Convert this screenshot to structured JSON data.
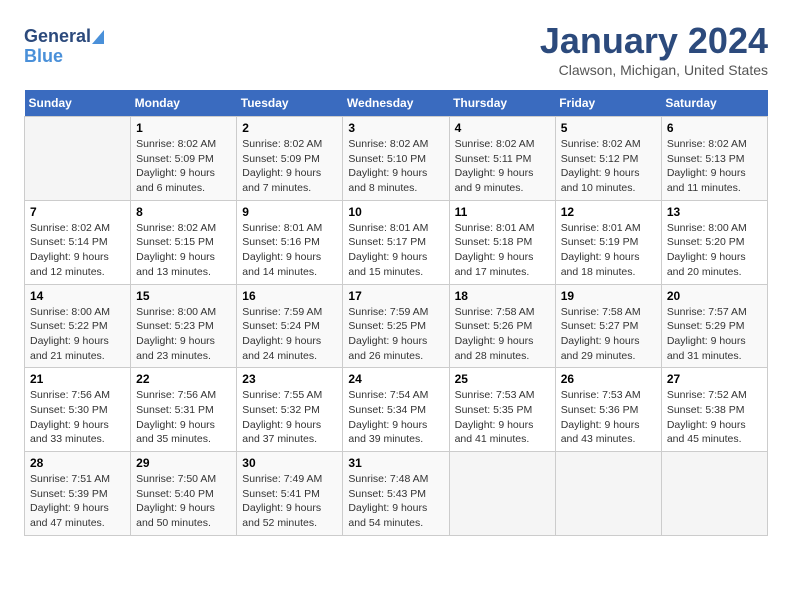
{
  "header": {
    "logo_general": "General",
    "logo_blue": "Blue",
    "main_title": "January 2024",
    "subtitle": "Clawson, Michigan, United States"
  },
  "calendar": {
    "days_of_week": [
      "Sunday",
      "Monday",
      "Tuesday",
      "Wednesday",
      "Thursday",
      "Friday",
      "Saturday"
    ],
    "weeks": [
      [
        {
          "day": "",
          "info": ""
        },
        {
          "day": "1",
          "info": "Sunrise: 8:02 AM\nSunset: 5:09 PM\nDaylight: 9 hours\nand 6 minutes."
        },
        {
          "day": "2",
          "info": "Sunrise: 8:02 AM\nSunset: 5:09 PM\nDaylight: 9 hours\nand 7 minutes."
        },
        {
          "day": "3",
          "info": "Sunrise: 8:02 AM\nSunset: 5:10 PM\nDaylight: 9 hours\nand 8 minutes."
        },
        {
          "day": "4",
          "info": "Sunrise: 8:02 AM\nSunset: 5:11 PM\nDaylight: 9 hours\nand 9 minutes."
        },
        {
          "day": "5",
          "info": "Sunrise: 8:02 AM\nSunset: 5:12 PM\nDaylight: 9 hours\nand 10 minutes."
        },
        {
          "day": "6",
          "info": "Sunrise: 8:02 AM\nSunset: 5:13 PM\nDaylight: 9 hours\nand 11 minutes."
        }
      ],
      [
        {
          "day": "7",
          "info": "Sunrise: 8:02 AM\nSunset: 5:14 PM\nDaylight: 9 hours\nand 12 minutes."
        },
        {
          "day": "8",
          "info": "Sunrise: 8:02 AM\nSunset: 5:15 PM\nDaylight: 9 hours\nand 13 minutes."
        },
        {
          "day": "9",
          "info": "Sunrise: 8:01 AM\nSunset: 5:16 PM\nDaylight: 9 hours\nand 14 minutes."
        },
        {
          "day": "10",
          "info": "Sunrise: 8:01 AM\nSunset: 5:17 PM\nDaylight: 9 hours\nand 15 minutes."
        },
        {
          "day": "11",
          "info": "Sunrise: 8:01 AM\nSunset: 5:18 PM\nDaylight: 9 hours\nand 17 minutes."
        },
        {
          "day": "12",
          "info": "Sunrise: 8:01 AM\nSunset: 5:19 PM\nDaylight: 9 hours\nand 18 minutes."
        },
        {
          "day": "13",
          "info": "Sunrise: 8:00 AM\nSunset: 5:20 PM\nDaylight: 9 hours\nand 20 minutes."
        }
      ],
      [
        {
          "day": "14",
          "info": "Sunrise: 8:00 AM\nSunset: 5:22 PM\nDaylight: 9 hours\nand 21 minutes."
        },
        {
          "day": "15",
          "info": "Sunrise: 8:00 AM\nSunset: 5:23 PM\nDaylight: 9 hours\nand 23 minutes."
        },
        {
          "day": "16",
          "info": "Sunrise: 7:59 AM\nSunset: 5:24 PM\nDaylight: 9 hours\nand 24 minutes."
        },
        {
          "day": "17",
          "info": "Sunrise: 7:59 AM\nSunset: 5:25 PM\nDaylight: 9 hours\nand 26 minutes."
        },
        {
          "day": "18",
          "info": "Sunrise: 7:58 AM\nSunset: 5:26 PM\nDaylight: 9 hours\nand 28 minutes."
        },
        {
          "day": "19",
          "info": "Sunrise: 7:58 AM\nSunset: 5:27 PM\nDaylight: 9 hours\nand 29 minutes."
        },
        {
          "day": "20",
          "info": "Sunrise: 7:57 AM\nSunset: 5:29 PM\nDaylight: 9 hours\nand 31 minutes."
        }
      ],
      [
        {
          "day": "21",
          "info": "Sunrise: 7:56 AM\nSunset: 5:30 PM\nDaylight: 9 hours\nand 33 minutes."
        },
        {
          "day": "22",
          "info": "Sunrise: 7:56 AM\nSunset: 5:31 PM\nDaylight: 9 hours\nand 35 minutes."
        },
        {
          "day": "23",
          "info": "Sunrise: 7:55 AM\nSunset: 5:32 PM\nDaylight: 9 hours\nand 37 minutes."
        },
        {
          "day": "24",
          "info": "Sunrise: 7:54 AM\nSunset: 5:34 PM\nDaylight: 9 hours\nand 39 minutes."
        },
        {
          "day": "25",
          "info": "Sunrise: 7:53 AM\nSunset: 5:35 PM\nDaylight: 9 hours\nand 41 minutes."
        },
        {
          "day": "26",
          "info": "Sunrise: 7:53 AM\nSunset: 5:36 PM\nDaylight: 9 hours\nand 43 minutes."
        },
        {
          "day": "27",
          "info": "Sunrise: 7:52 AM\nSunset: 5:38 PM\nDaylight: 9 hours\nand 45 minutes."
        }
      ],
      [
        {
          "day": "28",
          "info": "Sunrise: 7:51 AM\nSunset: 5:39 PM\nDaylight: 9 hours\nand 47 minutes."
        },
        {
          "day": "29",
          "info": "Sunrise: 7:50 AM\nSunset: 5:40 PM\nDaylight: 9 hours\nand 50 minutes."
        },
        {
          "day": "30",
          "info": "Sunrise: 7:49 AM\nSunset: 5:41 PM\nDaylight: 9 hours\nand 52 minutes."
        },
        {
          "day": "31",
          "info": "Sunrise: 7:48 AM\nSunset: 5:43 PM\nDaylight: 9 hours\nand 54 minutes."
        },
        {
          "day": "",
          "info": ""
        },
        {
          "day": "",
          "info": ""
        },
        {
          "day": "",
          "info": ""
        }
      ]
    ]
  }
}
